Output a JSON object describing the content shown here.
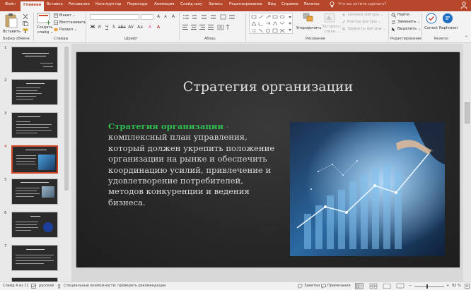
{
  "tabs": [
    "Файл",
    "Главная",
    "Вставка",
    "Рисование",
    "Конструктор",
    "Переходы",
    "Анимация",
    "Слайд-шоу",
    "Запись",
    "Рецензирование",
    "Вид",
    "Справка",
    "Reverso"
  ],
  "active_tab": "Главная",
  "tell_me": "Что вы хотите сделать?",
  "ribbon": {
    "clipboard": {
      "paste": "Вставить",
      "group": "Буфер обмена"
    },
    "slides": {
      "new_slide_1": "Создать",
      "new_slide_2": "слайд ⌄",
      "layout": "Макет ⌄",
      "reset": "Восстановить",
      "section": "Раздел ⌄",
      "group": "Слайды"
    },
    "font": {
      "font_name": "",
      "font_size": "",
      "group": "Шрифт"
    },
    "paragraph": {
      "group": "Абзац"
    },
    "drawing": {
      "arrange": "Упорядочить",
      "quick_styles_1": "Экспресс-",
      "quick_styles_2": "стили ⌄",
      "fill": "Заливка фигуры ⌄",
      "outline": "Контур фигуры ⌄",
      "effects": "Эффекты фигуры ⌄",
      "group": "Рисование"
    },
    "editing": {
      "find": "Найти",
      "replace": "Заменить ⌄",
      "select": "Выделить ⌄",
      "group": "Редактирование"
    },
    "reverso": {
      "correct": "Correct",
      "rephraser": "Rephraser",
      "group": "Reverso"
    }
  },
  "thumbnails": [
    {
      "number": "1",
      "active": false
    },
    {
      "number": "2",
      "active": false
    },
    {
      "number": "3",
      "active": false
    },
    {
      "number": "4",
      "active": true
    },
    {
      "number": "5",
      "active": false
    },
    {
      "number": "6",
      "active": false
    },
    {
      "number": "7",
      "active": false
    }
  ],
  "slide": {
    "title": "Стратегия организации",
    "body_highlight": "Стратегия организации",
    "body_dash": " -",
    "body_text": " комплексный план управления, который должен укрепить положение организации на рынке и обеспечить координацию усилий, привлечение и удовлетворение потребителей, методов конкуренции и ведения бизнеса."
  },
  "status": {
    "slide_counter": "Слайд 4 из 11",
    "language": "русский",
    "accessibility": "Специальные возможности: проверить рекомендации",
    "notes": "Заметки",
    "comments": "Примечания",
    "zoom": "92 %"
  },
  "colors": {
    "accent": "#b7472a",
    "highlight_text": "#2fbd4f",
    "slide_bg": "#262626"
  }
}
